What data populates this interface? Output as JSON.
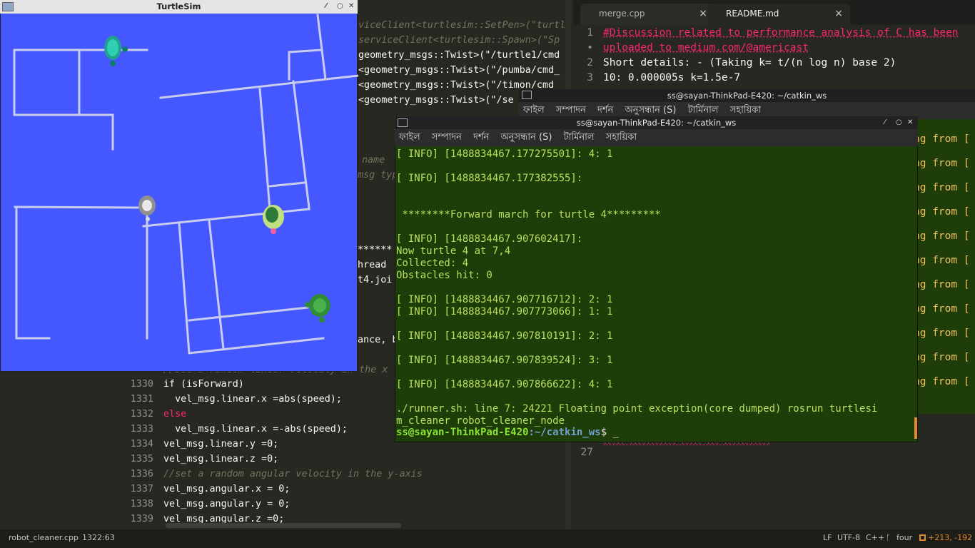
{
  "left_editor": {
    "top_code": [
      "viceClient<turtlesim::SetPen>(\"turtl",
      "serviceClient<turtlesim::Spawn>(\"Sp",
      "geometry_msgs::Twist>(\"/turtle1/cmd",
      "<geometry_msgs::Twist>(\"/pumba/cmd_",
      "<geometry_msgs::Twist>(\"/timon/cmd",
      "<geometry_msgs::Twist>(\"/se"
    ],
    "mid_code": [
      "name",
      "msg typ",
      "******",
      "hread",
      "t4.joi",
      "ance, b"
    ],
    "lines": [
      {
        "n": "1330",
        "t": "if (isForward)"
      },
      {
        "n": "1331",
        "t": "  vel_msg.linear.x =abs(speed);"
      },
      {
        "n": "1332",
        "t": "else"
      },
      {
        "n": "1333",
        "t": "  vel_msg.linear.x =-abs(speed);"
      },
      {
        "n": "1334",
        "t": "vel_msg.linear.y =0;"
      },
      {
        "n": "1335",
        "t": "vel_msg.linear.z =0;"
      },
      {
        "n": "1336",
        "t": "//set a random angular velocity in the y-axis"
      },
      {
        "n": "1337",
        "t": "vel_msg.angular.x = 0;"
      },
      {
        "n": "1338",
        "t": "vel_msg.angular.y = 0;"
      },
      {
        "n": "1339",
        "t": "vel_msg.angular.z =0;"
      }
    ],
    "partial_comment": "//set a random linear velocity in the x"
  },
  "right_editor": {
    "tabs": [
      {
        "label": "merge.cpp",
        "active": false
      },
      {
        "label": "README.md",
        "active": true
      }
    ],
    "close_glyph": "×",
    "lines": [
      {
        "n": "1",
        "t": "#Discussion related to performance analysis of C has been"
      },
      {
        "n": "•",
        "t": "uploaded to medium.com/@americast"
      },
      {
        "n": "2",
        "t": "Short details: - (Taking k= t/(n log n) base 2)"
      },
      {
        "n": "3",
        "t": "10: 0.000005s k=1.5e-7"
      }
    ],
    "line27": "27",
    "hidden_line": "..... ........... ..... ... ..........."
  },
  "turtlesim": {
    "title": "TurtleSim",
    "bg_color": "#4557ff",
    "path_color": "#c8cdee"
  },
  "terminal_back": {
    "title": "ss@sayan-ThinkPad-E420: ~/catkin_ws",
    "menu": [
      "ফাইল",
      "সম্পাদন",
      "দর্শন",
      "অনুসন্ধান (S)",
      "টার্মিনাল",
      "সহায়িকা"
    ],
    "fragments": [
      "ng from [",
      "ng from [",
      "ng from [",
      "ng from [",
      "ng from [",
      "ng from [",
      "ng from [",
      "ng from [",
      "ng from [",
      "ng from [",
      "ng from ["
    ]
  },
  "terminal_front": {
    "title": "ss@sayan-ThinkPad-E420: ~/catkin_ws",
    "menu": [
      "ফাইল",
      "সম্পাদন",
      "দর্শন",
      "অনুসন্ধান (S)",
      "টার্মিনাল",
      "সহায়িকা"
    ],
    "lines": [
      "[ INFO] [1488834467.177275501]: 4: 1",
      "",
      "[ INFO] [1488834467.177382555]:",
      "",
      "",
      " ********Forward march for turtle 4*********",
      "",
      "[ INFO] [1488834467.907602417]:",
      "Now turtle 4 at 7,4",
      "Collected: 4",
      "Obstacles hit: 0",
      "",
      "[ INFO] [1488834467.907716712]: 2: 1",
      "[ INFO] [1488834467.907773066]: 1: 1",
      "",
      "[ INFO] [1488834467.907810191]: 2: 1",
      "",
      "[ INFO] [1488834467.907839524]: 3: 1",
      "",
      "[ INFO] [1488834467.907866622]: 4: 1",
      "",
      "./runner.sh: line 7: 24221 Floating point exception(core dumped) rosrun turtlesi",
      "m_cleaner robot_cleaner_node"
    ],
    "prompt_user": "ss@sayan-ThinkPad-E420",
    "prompt_path": ":~/catkin_ws",
    "prompt_symbol": "$ _"
  },
  "statusbar": {
    "file": "robot_cleaner.cpp",
    "position": "1322:63",
    "line_ending": "LF",
    "encoding": "UTF-8",
    "language": "C++",
    "branch": "four",
    "diff": "+213, -192"
  }
}
